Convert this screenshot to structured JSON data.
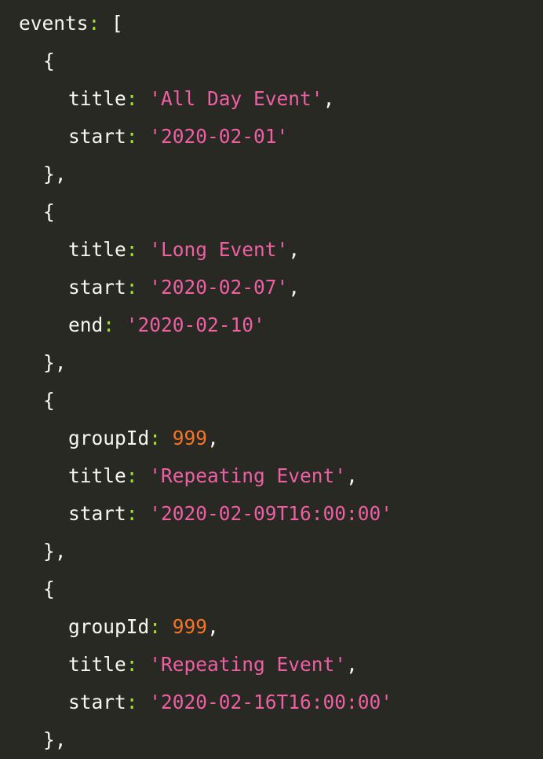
{
  "colors": {
    "background": "#282923",
    "text": "#f8f8f2",
    "colon": "#a6e22e",
    "string": "#ee5fa4",
    "number": "#f4752a"
  },
  "code": {
    "l1": {
      "key": "events",
      "colon": ":",
      "rest": " ["
    },
    "l2": {
      "punct": "{"
    },
    "l3": {
      "key": "title",
      "colon": ":",
      "value": "'All Day Event'",
      "trail": ","
    },
    "l4": {
      "key": "start",
      "colon": ":",
      "value": "'2020-02-01'"
    },
    "l5": {
      "punct": "},"
    },
    "l6": {
      "punct": "{"
    },
    "l7": {
      "key": "title",
      "colon": ":",
      "value": "'Long Event'",
      "trail": ","
    },
    "l8": {
      "key": "start",
      "colon": ":",
      "value": "'2020-02-07'",
      "trail": ","
    },
    "l9": {
      "key": "end",
      "colon": ":",
      "value": "'2020-02-10'"
    },
    "l10": {
      "punct": "},"
    },
    "l11": {
      "punct": "{"
    },
    "l12": {
      "key": "groupId",
      "colon": ":",
      "value": "999",
      "trail": ","
    },
    "l13": {
      "key": "title",
      "colon": ":",
      "value": "'Repeating Event'",
      "trail": ","
    },
    "l14": {
      "key": "start",
      "colon": ":",
      "value": "'2020-02-09T16:00:00'"
    },
    "l15": {
      "punct": "},"
    },
    "l16": {
      "punct": "{"
    },
    "l17": {
      "key": "groupId",
      "colon": ":",
      "value": "999",
      "trail": ","
    },
    "l18": {
      "key": "title",
      "colon": ":",
      "value": "'Repeating Event'",
      "trail": ","
    },
    "l19": {
      "key": "start",
      "colon": ":",
      "value": "'2020-02-16T16:00:00'"
    },
    "l20": {
      "punct": "},"
    }
  }
}
